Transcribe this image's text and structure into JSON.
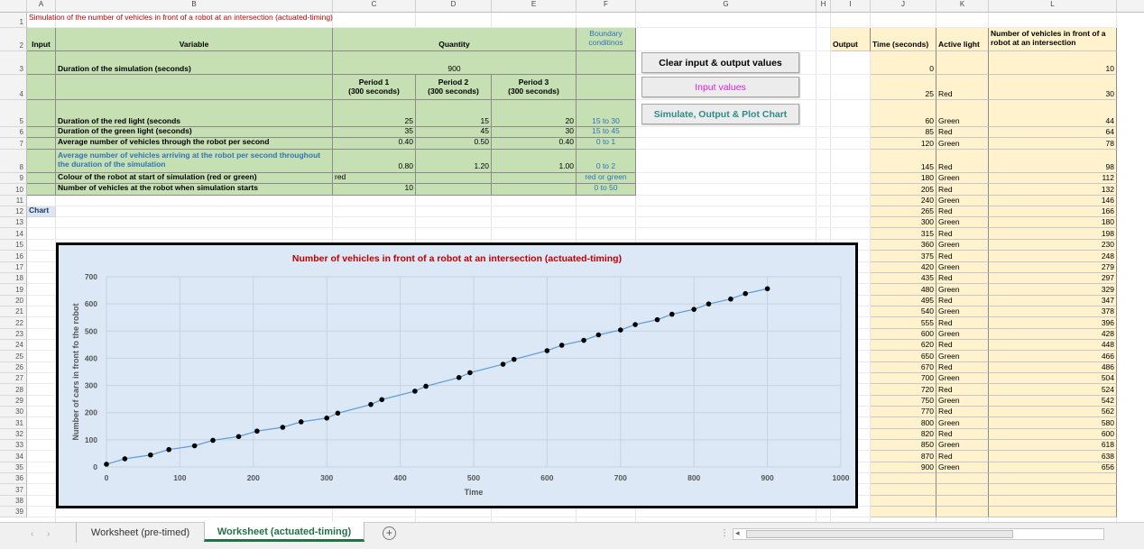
{
  "sheet": {
    "title": "Simulation of the number of vehicles in front of a robot at an intersection (actuated-timing)",
    "columns": [
      "A",
      "B",
      "C",
      "D",
      "E",
      "F",
      "G",
      "H",
      "I",
      "J",
      "K",
      "L"
    ],
    "rows": [
      "1",
      "2",
      "3",
      "4",
      "5",
      "6",
      "7",
      "8",
      "9",
      "10",
      "11",
      "12",
      "13",
      "14",
      "15",
      "16",
      "17",
      "18",
      "19",
      "20",
      "21",
      "22",
      "23",
      "24",
      "25",
      "26",
      "27",
      "28",
      "29",
      "30",
      "31",
      "32",
      "33",
      "34",
      "35",
      "36",
      "37",
      "38",
      "39"
    ],
    "input_label": "Input",
    "variable_header": "Variable",
    "quantity_header": "Quantity",
    "boundary_header_1": "Boundary",
    "boundary_header_2": "conditinos",
    "duration_label": "Duration of the simulation (seconds)",
    "duration_value": "900",
    "period1_a": "Period 1",
    "period1_b": "(300 seconds)",
    "period2_a": "Period 2",
    "period2_b": "(300 seconds)",
    "period3_a": "Period 3",
    "period3_b": "(300 seconds)",
    "red_label": "Duration of the red light (seconds",
    "red_values": [
      "25",
      "15",
      "20"
    ],
    "red_bound": "15 to 30",
    "green_label": "Duration of the green light (seconds)",
    "green_values": [
      "35",
      "45",
      "30"
    ],
    "green_bound": "15 to 45",
    "through_label": "Average number of vehicles through the robot per second",
    "through_values": [
      "0.40",
      "0.50",
      "0.40"
    ],
    "through_bound": "0 to 1",
    "arrive_label_1": "Average number of vehicles arriving at the robot per second throughout",
    "arrive_label_2": "the duration of the simulation",
    "arrive_values": [
      "0.80",
      "1.20",
      "1.00"
    ],
    "arrive_bound": "0 to 2",
    "colour_label": "Colour of the robot at start of simulation (red or green)",
    "colour_value": "red",
    "colour_bound": "red or green",
    "start_label": "Number of vehicles at the robot when simulation starts",
    "start_value": "10",
    "start_bound": "0 to 50",
    "chart_label": "Chart"
  },
  "buttons": {
    "clear": "Clear input & output values",
    "input": "Input values",
    "simulate": "Simulate, Output & Plot Chart"
  },
  "output": {
    "label": "Output",
    "col_time": "Time (seconds)",
    "col_light": "Active light",
    "col_vehicles_1": "Number of vehicles in front of a",
    "col_vehicles_2": "robot at an intersection",
    "rows": [
      [
        "0",
        "",
        "10"
      ],
      [
        "25",
        "Red",
        "30"
      ],
      [
        "60",
        "Green",
        "44"
      ],
      [
        "85",
        "Red",
        "64"
      ],
      [
        "120",
        "Green",
        "78"
      ],
      [
        "145",
        "Red",
        "98"
      ],
      [
        "180",
        "Green",
        "112"
      ],
      [
        "205",
        "Red",
        "132"
      ],
      [
        "240",
        "Green",
        "146"
      ],
      [
        "265",
        "Red",
        "166"
      ],
      [
        "300",
        "Green",
        "180"
      ],
      [
        "315",
        "Red",
        "198"
      ],
      [
        "360",
        "Green",
        "230"
      ],
      [
        "375",
        "Red",
        "248"
      ],
      [
        "420",
        "Green",
        "279"
      ],
      [
        "435",
        "Red",
        "297"
      ],
      [
        "480",
        "Green",
        "329"
      ],
      [
        "495",
        "Red",
        "347"
      ],
      [
        "540",
        "Green",
        "378"
      ],
      [
        "555",
        "Red",
        "396"
      ],
      [
        "600",
        "Green",
        "428"
      ],
      [
        "620",
        "Red",
        "448"
      ],
      [
        "650",
        "Green",
        "466"
      ],
      [
        "670",
        "Red",
        "486"
      ],
      [
        "700",
        "Green",
        "504"
      ],
      [
        "720",
        "Red",
        "524"
      ],
      [
        "750",
        "Green",
        "542"
      ],
      [
        "770",
        "Red",
        "562"
      ],
      [
        "800",
        "Green",
        "580"
      ],
      [
        "820",
        "Red",
        "600"
      ],
      [
        "850",
        "Green",
        "618"
      ],
      [
        "870",
        "Red",
        "638"
      ],
      [
        "900",
        "Green",
        "656"
      ]
    ]
  },
  "chart_data": {
    "type": "line",
    "title": "Number of vehicles in front of a robot at an intersection (actuated-timing)",
    "xlabel": "Time",
    "ylabel": "Number of cars in front fo the robot",
    "xlim": [
      0,
      1000
    ],
    "ylim": [
      0,
      700
    ],
    "xticks": [
      "0",
      "100",
      "200",
      "300",
      "400",
      "500",
      "600",
      "700",
      "800",
      "900",
      "1000"
    ],
    "yticks": [
      "0",
      "100",
      "200",
      "300",
      "400",
      "500",
      "600",
      "700"
    ],
    "grid": true,
    "x": [
      0,
      25,
      60,
      85,
      120,
      145,
      180,
      205,
      240,
      265,
      300,
      315,
      360,
      375,
      420,
      435,
      480,
      495,
      540,
      555,
      600,
      620,
      650,
      670,
      700,
      720,
      750,
      770,
      800,
      820,
      850,
      870,
      900
    ],
    "y": [
      10,
      30,
      44,
      64,
      78,
      98,
      112,
      132,
      146,
      166,
      180,
      198,
      230,
      248,
      279,
      297,
      329,
      347,
      378,
      396,
      428,
      448,
      466,
      486,
      504,
      524,
      542,
      562,
      580,
      600,
      618,
      638,
      656
    ]
  },
  "tabs": {
    "tab1": "Worksheet (pre-timed)",
    "tab2": "Worksheet (actuated-timing)"
  },
  "colors": {
    "green_fill": "#c6e0b4",
    "yellow_fill": "#fff2cc",
    "title_red": "#c00000",
    "accent_blue": "#2e75b6",
    "button_magenta": "#e020e0",
    "button_teal": "#2e8b8b",
    "chart_bg": "#dce8f5",
    "series_line": "#5b9bd5",
    "active_tab": "#217346"
  }
}
